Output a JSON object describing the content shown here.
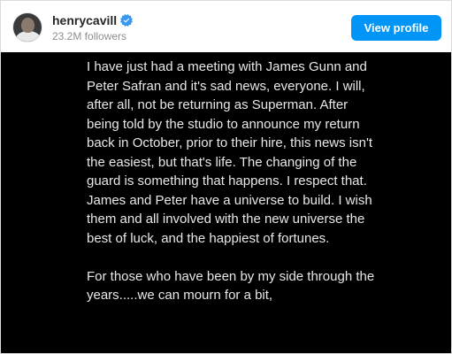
{
  "header": {
    "username": "henrycavill",
    "followers": "23.2M followers",
    "view_profile_label": "View profile",
    "colors": {
      "accent": "#0095f6",
      "verified": "#3897f0"
    }
  },
  "post": {
    "paragraphs": [
      "I have just had a meeting with James Gunn and Peter Safran and it's sad news, everyone. I will, after all, not be returning as Superman. After being told by the studio to announce my return back in October, prior to their hire, this news isn't the easiest, but that's life. The changing of the guard is something that happens. I respect that. James and Peter have a universe to build. I wish them and all involved with the new universe the best of luck, and the happiest of fortunes.",
      "For those who have been by my side through the years.....we can mourn for a bit,"
    ],
    "background": "#000000"
  }
}
